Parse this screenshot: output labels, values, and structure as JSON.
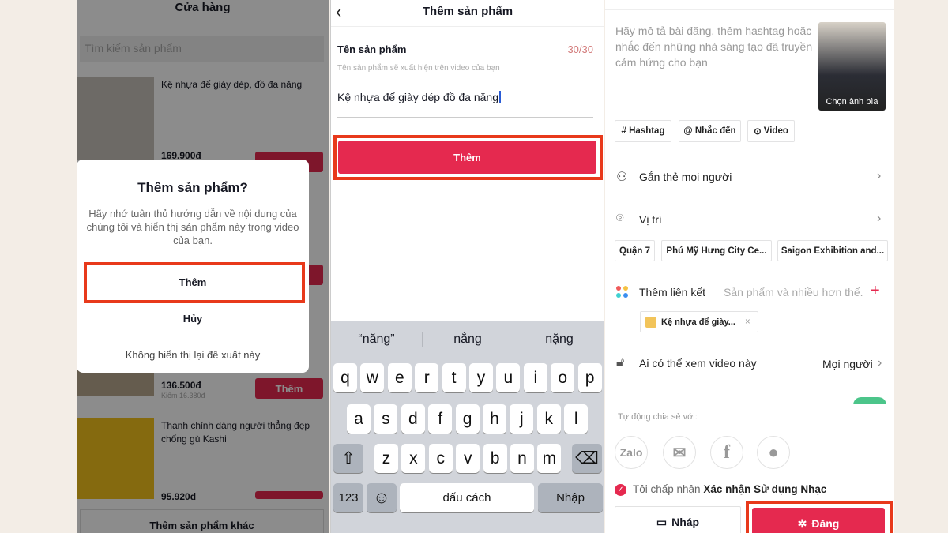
{
  "shop": {
    "title": "Cửa hàng",
    "search_placeholder": "Tìm kiếm sản phẩm",
    "products": [
      {
        "name": "Kệ nhựa để giày dép, đồ đa năng",
        "price": "169.900đ"
      },
      {
        "name": "",
        "price": "136.500đ",
        "commission": "Kiếm 16.380đ",
        "button": "Thêm"
      },
      {
        "name": "Thanh chỉnh dáng người thẳng đẹp chống gù Kashi",
        "price": "95.920đ"
      }
    ],
    "more_button": "Thêm sản phẩm khác",
    "dialog": {
      "title": "Thêm sản phẩm?",
      "message": "Hãy nhớ tuân thủ hướng dẫn về nội dung của chúng tôi và hiển thị sản phẩm này trong video của bạn.",
      "confirm": "Thêm",
      "cancel": "Hủy",
      "dont_show": "Không hiển thị lại đề xuất này"
    }
  },
  "add_product": {
    "title": "Thêm sản phẩm",
    "field_label": "Tên sản phẩm",
    "counter": "30/30",
    "hint": "Tên sản phẩm sẽ xuất hiện trên video của bạn",
    "value": "Kệ nhựa để giày dép đồ đa năng",
    "submit": "Thêm",
    "keyboard": {
      "suggestions": [
        "“năng”",
        "nắng",
        "nặng"
      ],
      "row1": [
        "q",
        "w",
        "e",
        "r",
        "t",
        "y",
        "u",
        "i",
        "o",
        "p"
      ],
      "row2": [
        "a",
        "s",
        "d",
        "f",
        "g",
        "h",
        "j",
        "k",
        "l"
      ],
      "row3": [
        "z",
        "x",
        "c",
        "v",
        "b",
        "n",
        "m"
      ],
      "num": "123",
      "space": "dấu cách",
      "enter": "Nhập"
    }
  },
  "post": {
    "caption_placeholder": "Hãy mô tả bài đăng, thêm hashtag hoặc nhắc đến những nhà sáng tạo đã truyền cảm hứng cho bạn",
    "cover_label": "Chọn ảnh bìa",
    "chips": [
      "# Hashtag",
      "@ Nhắc đến",
      "Video"
    ],
    "tag_people": "Gắn thẻ mọi người",
    "location": "Vị trí",
    "locations": [
      "Quận 7",
      "Phú Mỹ Hưng City Ce...",
      "Saigon Exhibition and..."
    ],
    "add_link": "Thêm liên kết",
    "add_link_hint": "Sản phẩm và nhiều hơn thế.",
    "linked_product": "Kệ nhựa để giày...",
    "privacy_label": "Ai có thể xem video này",
    "privacy_value": "Mọi người",
    "auto_share": "Tự động chia sẻ với:",
    "zalo": "Zalo",
    "accept_prefix": "Tôi chấp nhận ",
    "accept_link": "Xác nhận Sử dụng Nhạc",
    "draft": "Nháp",
    "publish": "Đăng"
  },
  "colors": {
    "accent": "#e5294f",
    "highlight": "#e8391b",
    "background": "#f3ede6"
  }
}
